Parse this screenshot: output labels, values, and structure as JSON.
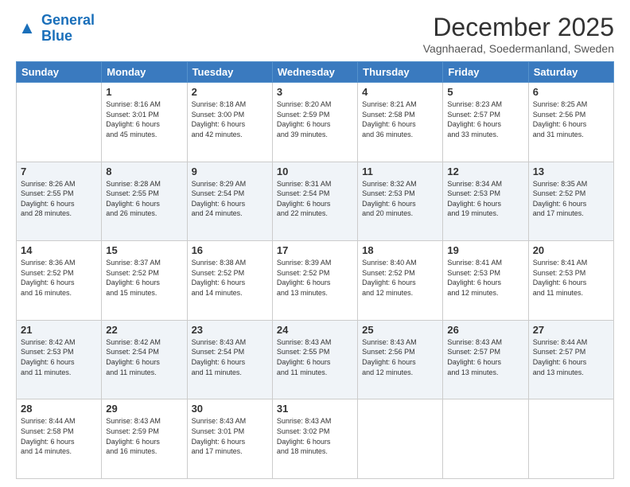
{
  "logo": {
    "line1": "General",
    "line2": "Blue"
  },
  "title": "December 2025",
  "location": "Vagnhaerad, Soedermanland, Sweden",
  "days_of_week": [
    "Sunday",
    "Monday",
    "Tuesday",
    "Wednesday",
    "Thursday",
    "Friday",
    "Saturday"
  ],
  "weeks": [
    [
      {
        "day": "",
        "info": ""
      },
      {
        "day": "1",
        "info": "Sunrise: 8:16 AM\nSunset: 3:01 PM\nDaylight: 6 hours\nand 45 minutes."
      },
      {
        "day": "2",
        "info": "Sunrise: 8:18 AM\nSunset: 3:00 PM\nDaylight: 6 hours\nand 42 minutes."
      },
      {
        "day": "3",
        "info": "Sunrise: 8:20 AM\nSunset: 2:59 PM\nDaylight: 6 hours\nand 39 minutes."
      },
      {
        "day": "4",
        "info": "Sunrise: 8:21 AM\nSunset: 2:58 PM\nDaylight: 6 hours\nand 36 minutes."
      },
      {
        "day": "5",
        "info": "Sunrise: 8:23 AM\nSunset: 2:57 PM\nDaylight: 6 hours\nand 33 minutes."
      },
      {
        "day": "6",
        "info": "Sunrise: 8:25 AM\nSunset: 2:56 PM\nDaylight: 6 hours\nand 31 minutes."
      }
    ],
    [
      {
        "day": "7",
        "info": "Sunrise: 8:26 AM\nSunset: 2:55 PM\nDaylight: 6 hours\nand 28 minutes."
      },
      {
        "day": "8",
        "info": "Sunrise: 8:28 AM\nSunset: 2:55 PM\nDaylight: 6 hours\nand 26 minutes."
      },
      {
        "day": "9",
        "info": "Sunrise: 8:29 AM\nSunset: 2:54 PM\nDaylight: 6 hours\nand 24 minutes."
      },
      {
        "day": "10",
        "info": "Sunrise: 8:31 AM\nSunset: 2:54 PM\nDaylight: 6 hours\nand 22 minutes."
      },
      {
        "day": "11",
        "info": "Sunrise: 8:32 AM\nSunset: 2:53 PM\nDaylight: 6 hours\nand 20 minutes."
      },
      {
        "day": "12",
        "info": "Sunrise: 8:34 AM\nSunset: 2:53 PM\nDaylight: 6 hours\nand 19 minutes."
      },
      {
        "day": "13",
        "info": "Sunrise: 8:35 AM\nSunset: 2:52 PM\nDaylight: 6 hours\nand 17 minutes."
      }
    ],
    [
      {
        "day": "14",
        "info": "Sunrise: 8:36 AM\nSunset: 2:52 PM\nDaylight: 6 hours\nand 16 minutes."
      },
      {
        "day": "15",
        "info": "Sunrise: 8:37 AM\nSunset: 2:52 PM\nDaylight: 6 hours\nand 15 minutes."
      },
      {
        "day": "16",
        "info": "Sunrise: 8:38 AM\nSunset: 2:52 PM\nDaylight: 6 hours\nand 14 minutes."
      },
      {
        "day": "17",
        "info": "Sunrise: 8:39 AM\nSunset: 2:52 PM\nDaylight: 6 hours\nand 13 minutes."
      },
      {
        "day": "18",
        "info": "Sunrise: 8:40 AM\nSunset: 2:52 PM\nDaylight: 6 hours\nand 12 minutes."
      },
      {
        "day": "19",
        "info": "Sunrise: 8:41 AM\nSunset: 2:53 PM\nDaylight: 6 hours\nand 12 minutes."
      },
      {
        "day": "20",
        "info": "Sunrise: 8:41 AM\nSunset: 2:53 PM\nDaylight: 6 hours\nand 11 minutes."
      }
    ],
    [
      {
        "day": "21",
        "info": "Sunrise: 8:42 AM\nSunset: 2:53 PM\nDaylight: 6 hours\nand 11 minutes."
      },
      {
        "day": "22",
        "info": "Sunrise: 8:42 AM\nSunset: 2:54 PM\nDaylight: 6 hours\nand 11 minutes."
      },
      {
        "day": "23",
        "info": "Sunrise: 8:43 AM\nSunset: 2:54 PM\nDaylight: 6 hours\nand 11 minutes."
      },
      {
        "day": "24",
        "info": "Sunrise: 8:43 AM\nSunset: 2:55 PM\nDaylight: 6 hours\nand 11 minutes."
      },
      {
        "day": "25",
        "info": "Sunrise: 8:43 AM\nSunset: 2:56 PM\nDaylight: 6 hours\nand 12 minutes."
      },
      {
        "day": "26",
        "info": "Sunrise: 8:43 AM\nSunset: 2:57 PM\nDaylight: 6 hours\nand 13 minutes."
      },
      {
        "day": "27",
        "info": "Sunrise: 8:44 AM\nSunset: 2:57 PM\nDaylight: 6 hours\nand 13 minutes."
      }
    ],
    [
      {
        "day": "28",
        "info": "Sunrise: 8:44 AM\nSunset: 2:58 PM\nDaylight: 6 hours\nand 14 minutes."
      },
      {
        "day": "29",
        "info": "Sunrise: 8:43 AM\nSunset: 2:59 PM\nDaylight: 6 hours\nand 16 minutes."
      },
      {
        "day": "30",
        "info": "Sunrise: 8:43 AM\nSunset: 3:01 PM\nDaylight: 6 hours\nand 17 minutes."
      },
      {
        "day": "31",
        "info": "Sunrise: 8:43 AM\nSunset: 3:02 PM\nDaylight: 6 hours\nand 18 minutes."
      },
      {
        "day": "",
        "info": ""
      },
      {
        "day": "",
        "info": ""
      },
      {
        "day": "",
        "info": ""
      }
    ]
  ]
}
